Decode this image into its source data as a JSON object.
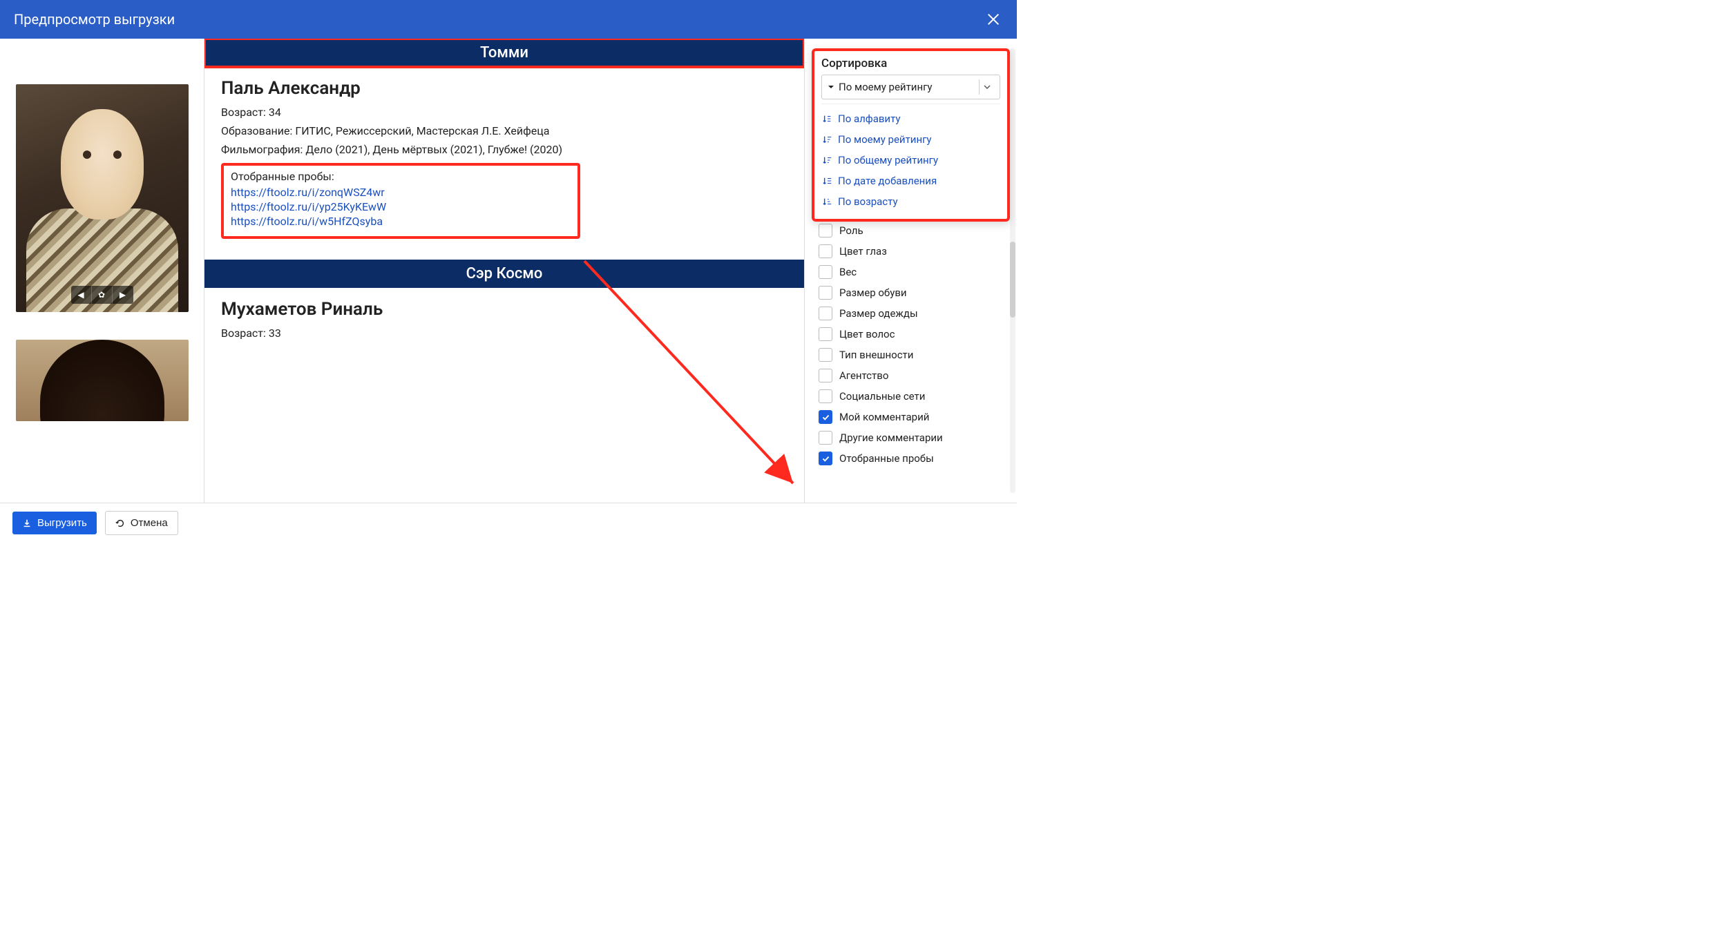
{
  "header": {
    "title": "Предпросмотр выгрузки"
  },
  "roles": [
    {
      "name": "Томми",
      "highlighted": true,
      "actor": {
        "name": "Паль Александр",
        "age_label": "Возраст:",
        "age": "34",
        "education_label": "Образование:",
        "education": "ГИТИС, Режиссерский, Мастерская Л.Е. Хейфеца",
        "filmography_label": "Фильмография:",
        "filmography": "Дело (2021), День мёртвых (2021), Глубже! (2020)",
        "probes_label": "Отобранные пробы:",
        "probes": [
          "https://ftoolz.ru/i/zonqWSZ4wr",
          "https://ftoolz.ru/i/yp25KyKEwW",
          "https://ftoolz.ru/i/w5HfZQsyba"
        ]
      }
    },
    {
      "name": "Сэр Космо",
      "actor": {
        "name": "Мухаметов Риналь",
        "age_label": "Возраст:",
        "age": "33"
      }
    }
  ],
  "sort": {
    "title": "Сортировка",
    "selected": "По моему рейтингу",
    "options": [
      "По алфавиту",
      "По моему рейтингу",
      "По общему рейтингу",
      "По дате добавления",
      "По возрасту"
    ]
  },
  "filters": [
    {
      "label": "Роль",
      "checked": false
    },
    {
      "label": "Цвет глаз",
      "checked": false
    },
    {
      "label": "Вес",
      "checked": false
    },
    {
      "label": "Размер обуви",
      "checked": false
    },
    {
      "label": "Размер одежды",
      "checked": false
    },
    {
      "label": "Цвет волос",
      "checked": false
    },
    {
      "label": "Тип внешности",
      "checked": false
    },
    {
      "label": "Агентство",
      "checked": false
    },
    {
      "label": "Социальные сети",
      "checked": false
    },
    {
      "label": "Мой комментарий",
      "checked": true
    },
    {
      "label": "Другие комментарии",
      "checked": false
    },
    {
      "label": "Отобранные пробы",
      "checked": true
    }
  ],
  "footer": {
    "export": "Выгрузить",
    "cancel": "Отмена"
  }
}
